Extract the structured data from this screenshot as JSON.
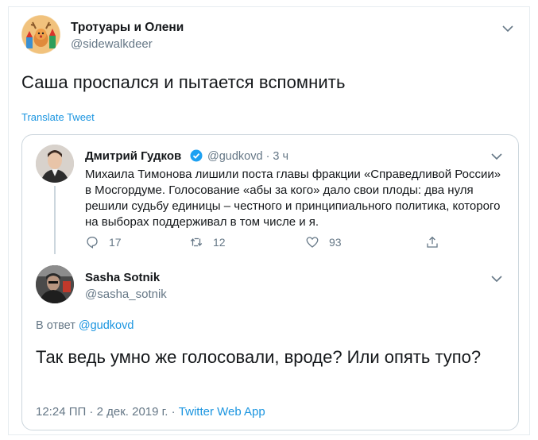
{
  "tweet": {
    "author_name": "Тротуары и Олени",
    "author_handle": "@sidewalkdeer",
    "text": "Саша проспался и пытается вспомнить",
    "translate_label": "Translate Tweet"
  },
  "quoted": {
    "original": {
      "author_name": "Дмитрий Гудков",
      "handle_time": "@gudkovd · 3 ч",
      "text": "Михаила Тимонова лишили поста главы фракции «Справедливой России» в Мосгордуме. Голосование «абы за кого» дало свои плоды: два нуля решили судьбу единицы – честного и принципиального политика, которого на выборах поддерживал в том числе и я.",
      "replies": "17",
      "retweets": "12",
      "likes": "93"
    },
    "reply": {
      "author_name": "Sasha Sotnik",
      "author_handle": "@sasha_sotnik",
      "reply_prefix": "В ответ",
      "reply_mention": "@gudkovd",
      "text": "Так ведь умно же голосовали, вроде? Или опять тупо?",
      "timestamp": "12:24 ПП · 2 дек. 2019 г. · ",
      "app": "Twitter Web App"
    }
  },
  "icons": {
    "more": "chevron-down-icon",
    "verified": "verified-badge-icon",
    "reply": "reply-icon",
    "retweet": "retweet-icon",
    "like": "heart-icon",
    "share": "share-icon"
  },
  "colors": {
    "accent": "#1b95e0",
    "secondary_text": "#657786",
    "border": "#ccd6dd"
  }
}
